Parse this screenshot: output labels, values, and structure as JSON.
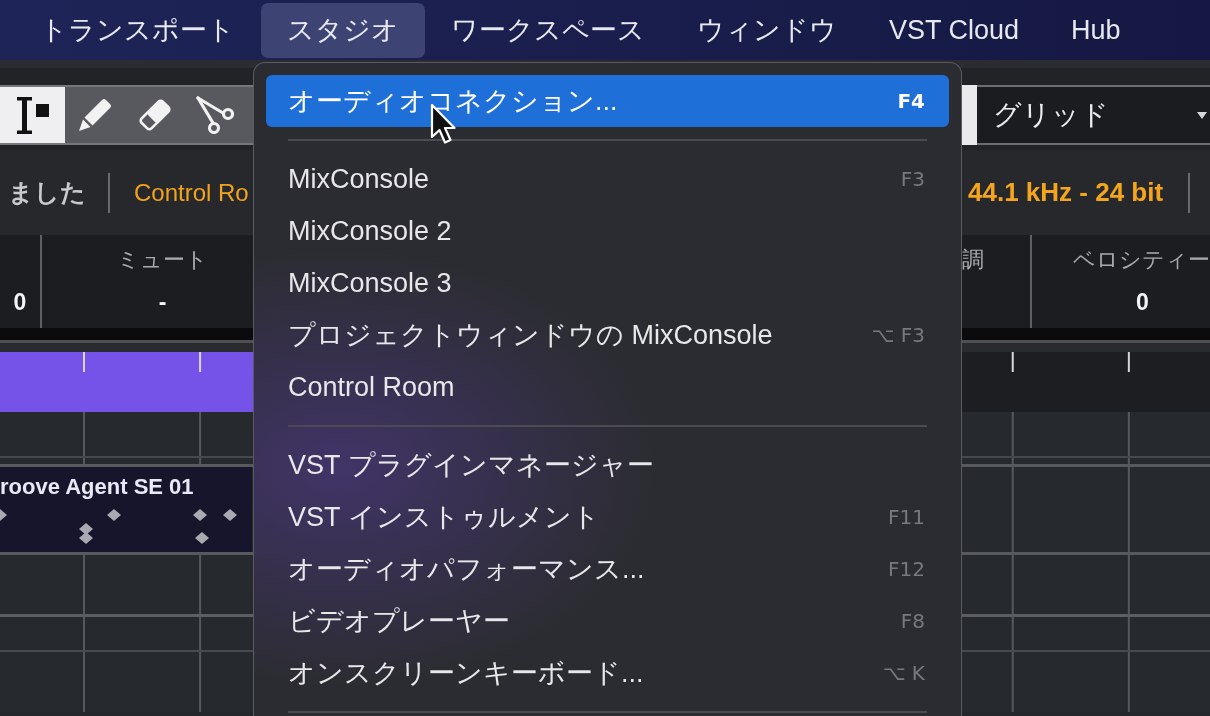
{
  "menubar": {
    "items": [
      {
        "label": "トランスポート",
        "selected": false
      },
      {
        "label": "スタジオ",
        "selected": true
      },
      {
        "label": "ワークスペース",
        "selected": false
      },
      {
        "label": "ウィンドウ",
        "selected": false
      },
      {
        "label": "VST Cloud",
        "selected": false
      },
      {
        "label": "Hub",
        "selected": false
      }
    ]
  },
  "toolbar": {
    "tools": [
      {
        "kind": "select",
        "selected": true
      },
      {
        "kind": "draw",
        "selected": false
      },
      {
        "kind": "erase",
        "selected": false
      },
      {
        "kind": "split",
        "selected": false
      }
    ],
    "right_button": {
      "selected": true
    },
    "snap_dropdown": {
      "value": "グリッド"
    }
  },
  "status_line": {
    "left": [
      {
        "kind": "message",
        "text": "ました"
      },
      {
        "kind": "port",
        "text": "Control Ro"
      }
    ],
    "right": [
      {
        "kind": "format",
        "text": "44.1 kHz - 24 bit"
      }
    ]
  },
  "info_line": {
    "left": [
      {
        "value": "0"
      },
      {
        "label": "ミュート",
        "value": "-"
      }
    ],
    "right": [
      {
        "label": "調"
      },
      {
        "label": "ベロシティー",
        "value": "0"
      }
    ]
  },
  "tracks": {
    "events": [
      {
        "name": "roove Agent SE 01"
      }
    ]
  },
  "studio_menu": {
    "items": [
      {
        "kind": "command",
        "label": "オーディオコネクション...",
        "shortcut": "F4",
        "selected": true
      },
      {
        "kind": "separator"
      },
      {
        "kind": "command",
        "label": "MixConsole",
        "shortcut": "F3",
        "selected": false
      },
      {
        "kind": "command",
        "label": "MixConsole 2",
        "selected": false
      },
      {
        "kind": "command",
        "label": "MixConsole 3",
        "selected": false
      },
      {
        "kind": "command",
        "label": "プロジェクトウィンドウの MixConsole",
        "shortcut": "⌥ F3",
        "selected": false
      },
      {
        "kind": "command",
        "label": "Control Room",
        "selected": false
      },
      {
        "kind": "separator"
      },
      {
        "kind": "command",
        "label": "VST プラグインマネージャー",
        "selected": false
      },
      {
        "kind": "command",
        "label": "VST インストゥルメント",
        "shortcut": "F11",
        "selected": false
      },
      {
        "kind": "command",
        "label": "オーディオパフォーマンス...",
        "shortcut": "F12",
        "selected": false
      },
      {
        "kind": "command",
        "label": "ビデオプレーヤー",
        "shortcut": "F8",
        "selected": false
      },
      {
        "kind": "command",
        "label": "オンスクリーンキーボード...",
        "shortcut": "⌥ K",
        "selected": false
      },
      {
        "kind": "separator"
      }
    ]
  }
}
